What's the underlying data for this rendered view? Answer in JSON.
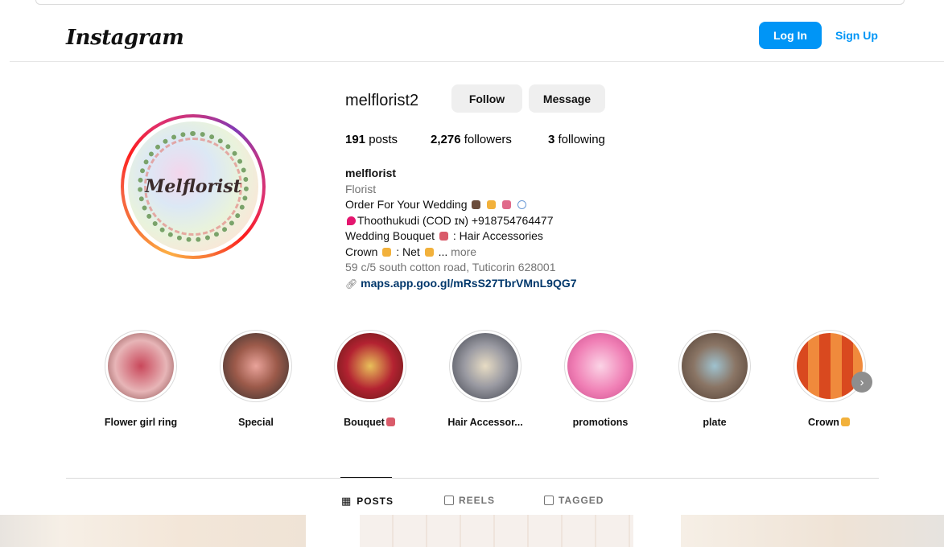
{
  "navbar": {
    "logo": "Instagram",
    "login_label": "Log In",
    "signup_label": "Sign Up"
  },
  "profile": {
    "username": "melflorist2",
    "follow_label": "Follow",
    "message_label": "Message",
    "avatar_text": "Melflorist",
    "stats": {
      "posts_count": "191",
      "posts_label": "posts",
      "followers_count": "2,276",
      "followers_label": "followers",
      "following_count": "3",
      "following_label": "following"
    },
    "bio": {
      "name": "melflorist",
      "category": "Florist",
      "line1": "Order For Your Wedding",
      "line2": "Thoothukudi (COD ɪɴ) +918754764477",
      "line3": "Wedding Bouquet",
      "line3b": ": Hair Accessories",
      "line4": "Crown",
      "line4b": ": Net",
      "line4c": "...",
      "more": "more",
      "address": "59 c/5 south cotton road, Tuticorin 628001",
      "link": "maps.app.goo.gl/mRsS27TbrVMnL9QG7"
    }
  },
  "highlights": [
    {
      "label": "Flower girl ring",
      "color": "#c9485b"
    },
    {
      "label": "Special",
      "color": "#9c5a4a"
    },
    {
      "label": "Bouquet",
      "color": "#b32231"
    },
    {
      "label": "Hair Accessor...",
      "color": "#5a5e6a"
    },
    {
      "label": "promotions",
      "color": "#f07fb5"
    },
    {
      "label": "plate",
      "color": "#6f5a4e"
    },
    {
      "label": "Crown",
      "color": "#d9491f"
    }
  ],
  "tabs": {
    "posts": "POSTS",
    "reels": "REELS",
    "tagged": "TAGGED"
  },
  "colors": {
    "accent": "#0095f6",
    "link": "#00376b",
    "muted": "#737373"
  }
}
